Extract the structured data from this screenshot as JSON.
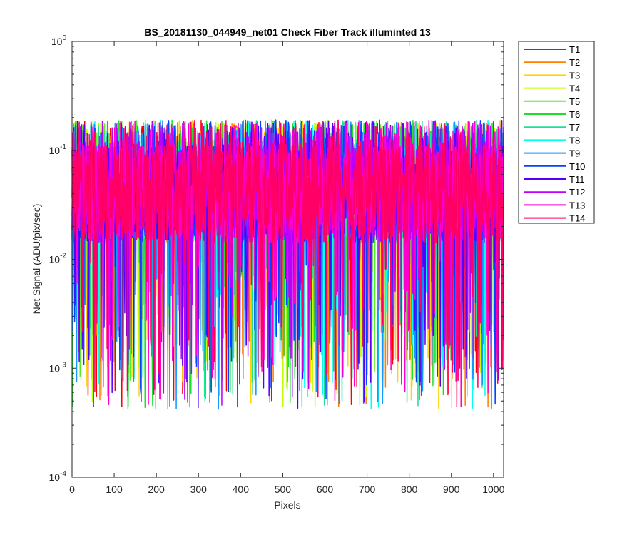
{
  "chart_data": {
    "type": "line",
    "title": "BS_20181130_044949_net01   Check Fiber     Track illuminted 13",
    "xlabel": "Pixels",
    "ylabel": "Net Signal (ADU/pix/sec)",
    "xlim": [
      0,
      1024
    ],
    "ylim": [
      0.0001,
      1
    ],
    "yscale": "log",
    "x_ticks": [
      "0",
      "100",
      "200",
      "300",
      "400",
      "500",
      "600",
      "700",
      "800",
      "900",
      "1000"
    ],
    "y_ticks": [
      {
        "base": "10",
        "exp": "-4",
        "value": 0.0001
      },
      {
        "base": "10",
        "exp": "-3",
        "value": 0.001
      },
      {
        "base": "10",
        "exp": "-2",
        "value": 0.01
      },
      {
        "base": "10",
        "exp": "-1",
        "value": 0.1
      },
      {
        "base": "10",
        "exp": "0",
        "value": 1
      }
    ],
    "grid": false,
    "legend_position": "outside-top-right",
    "series_style": {
      "points_per_series": 1024,
      "typical_value": 0.04,
      "max_value": 0.19,
      "min_value": 0.00042
    },
    "series": [
      {
        "name": "T1",
        "color": "#ff0000"
      },
      {
        "name": "T2",
        "color": "#ff7f00"
      },
      {
        "name": "T3",
        "color": "#ffd400"
      },
      {
        "name": "T4",
        "color": "#bfff00"
      },
      {
        "name": "T5",
        "color": "#55ee22"
      },
      {
        "name": "T6",
        "color": "#1fdd2f"
      },
      {
        "name": "T7",
        "color": "#22dd99"
      },
      {
        "name": "T8",
        "color": "#00ffee"
      },
      {
        "name": "T9",
        "color": "#1199ff"
      },
      {
        "name": "T10",
        "color": "#0044ff"
      },
      {
        "name": "T11",
        "color": "#5500ff"
      },
      {
        "name": "T12",
        "color": "#bb00ff"
      },
      {
        "name": "T13",
        "color": "#ff00cc"
      },
      {
        "name": "T14",
        "color": "#ff0066"
      }
    ]
  }
}
